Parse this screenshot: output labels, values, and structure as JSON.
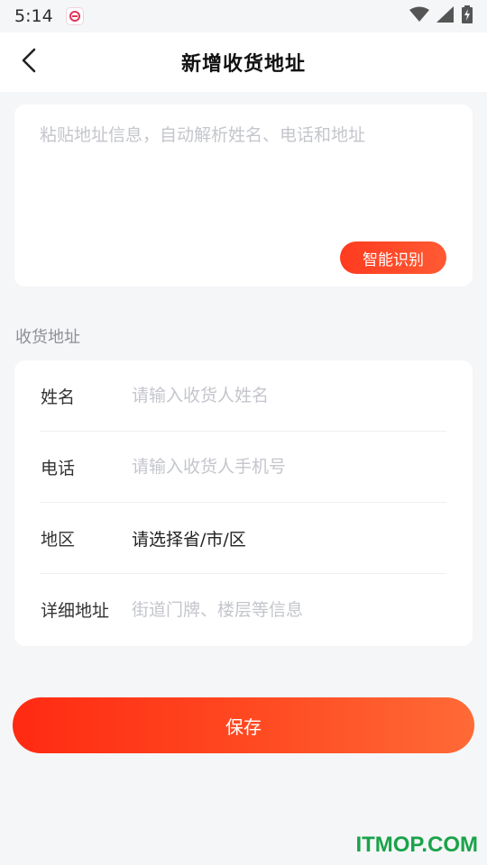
{
  "status_bar": {
    "time": "5:14",
    "icons": [
      "app-notification-icon",
      "wifi-icon",
      "signal-icon",
      "battery-charging-icon"
    ]
  },
  "nav": {
    "back_icon": "chevron-left-icon",
    "title": "新增收货地址"
  },
  "paste_box": {
    "placeholder": "粘贴地址信息，自动解析姓名、电话和地址",
    "value": "",
    "recognize_button": "智能识别"
  },
  "section": {
    "label": "收货地址"
  },
  "form": {
    "name": {
      "label": "姓名",
      "placeholder": "请输入收货人姓名",
      "value": ""
    },
    "phone": {
      "label": "电话",
      "placeholder": "请输入收货人手机号",
      "value": ""
    },
    "region": {
      "label": "地区",
      "value": "请选择省/市/区"
    },
    "detail": {
      "label": "详细地址",
      "placeholder": "街道门牌、楼层等信息",
      "value": ""
    }
  },
  "save_button": "保存",
  "watermark": "ITMOP.COM",
  "colors": {
    "accent": "#ff3b1f",
    "accent_end": "#ff6a36",
    "background": "#f5f6f8",
    "card": "#ffffff",
    "placeholder": "#c4c6cc",
    "section_label": "#8e9097",
    "watermark": "#1aa34a"
  }
}
